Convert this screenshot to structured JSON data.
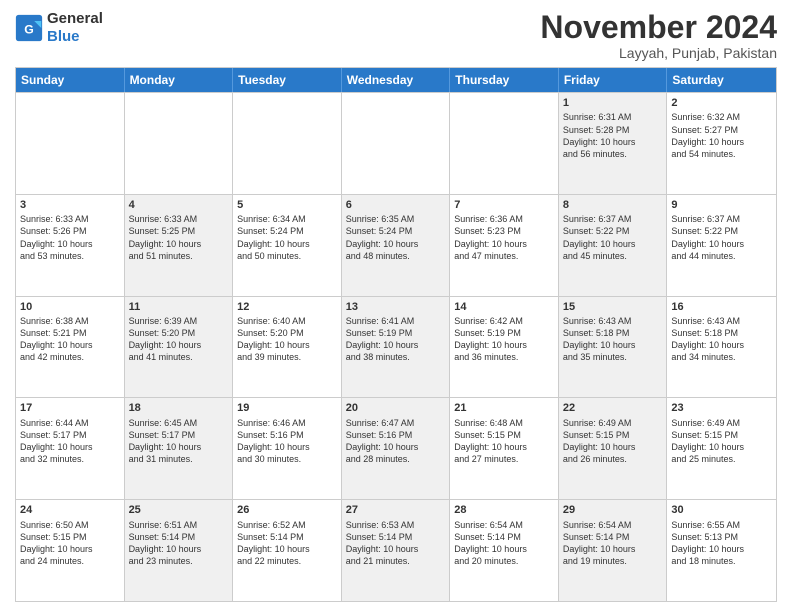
{
  "logo": {
    "line1": "General",
    "line2": "Blue"
  },
  "title": "November 2024",
  "location": "Layyah, Punjab, Pakistan",
  "header_days": [
    "Sunday",
    "Monday",
    "Tuesday",
    "Wednesday",
    "Thursday",
    "Friday",
    "Saturday"
  ],
  "rows": [
    {
      "cells": [
        {
          "day": "",
          "info": "",
          "shaded": false,
          "empty": true
        },
        {
          "day": "",
          "info": "",
          "shaded": false,
          "empty": true
        },
        {
          "day": "",
          "info": "",
          "shaded": false,
          "empty": true
        },
        {
          "day": "",
          "info": "",
          "shaded": false,
          "empty": true
        },
        {
          "day": "",
          "info": "",
          "shaded": false,
          "empty": true
        },
        {
          "day": "1",
          "info": "Sunrise: 6:31 AM\nSunset: 5:28 PM\nDaylight: 10 hours\nand 56 minutes.",
          "shaded": true,
          "empty": false
        },
        {
          "day": "2",
          "info": "Sunrise: 6:32 AM\nSunset: 5:27 PM\nDaylight: 10 hours\nand 54 minutes.",
          "shaded": false,
          "empty": false
        }
      ]
    },
    {
      "cells": [
        {
          "day": "3",
          "info": "Sunrise: 6:33 AM\nSunset: 5:26 PM\nDaylight: 10 hours\nand 53 minutes.",
          "shaded": false,
          "empty": false
        },
        {
          "day": "4",
          "info": "Sunrise: 6:33 AM\nSunset: 5:25 PM\nDaylight: 10 hours\nand 51 minutes.",
          "shaded": true,
          "empty": false
        },
        {
          "day": "5",
          "info": "Sunrise: 6:34 AM\nSunset: 5:24 PM\nDaylight: 10 hours\nand 50 minutes.",
          "shaded": false,
          "empty": false
        },
        {
          "day": "6",
          "info": "Sunrise: 6:35 AM\nSunset: 5:24 PM\nDaylight: 10 hours\nand 48 minutes.",
          "shaded": true,
          "empty": false
        },
        {
          "day": "7",
          "info": "Sunrise: 6:36 AM\nSunset: 5:23 PM\nDaylight: 10 hours\nand 47 minutes.",
          "shaded": false,
          "empty": false
        },
        {
          "day": "8",
          "info": "Sunrise: 6:37 AM\nSunset: 5:22 PM\nDaylight: 10 hours\nand 45 minutes.",
          "shaded": true,
          "empty": false
        },
        {
          "day": "9",
          "info": "Sunrise: 6:37 AM\nSunset: 5:22 PM\nDaylight: 10 hours\nand 44 minutes.",
          "shaded": false,
          "empty": false
        }
      ]
    },
    {
      "cells": [
        {
          "day": "10",
          "info": "Sunrise: 6:38 AM\nSunset: 5:21 PM\nDaylight: 10 hours\nand 42 minutes.",
          "shaded": false,
          "empty": false
        },
        {
          "day": "11",
          "info": "Sunrise: 6:39 AM\nSunset: 5:20 PM\nDaylight: 10 hours\nand 41 minutes.",
          "shaded": true,
          "empty": false
        },
        {
          "day": "12",
          "info": "Sunrise: 6:40 AM\nSunset: 5:20 PM\nDaylight: 10 hours\nand 39 minutes.",
          "shaded": false,
          "empty": false
        },
        {
          "day": "13",
          "info": "Sunrise: 6:41 AM\nSunset: 5:19 PM\nDaylight: 10 hours\nand 38 minutes.",
          "shaded": true,
          "empty": false
        },
        {
          "day": "14",
          "info": "Sunrise: 6:42 AM\nSunset: 5:19 PM\nDaylight: 10 hours\nand 36 minutes.",
          "shaded": false,
          "empty": false
        },
        {
          "day": "15",
          "info": "Sunrise: 6:43 AM\nSunset: 5:18 PM\nDaylight: 10 hours\nand 35 minutes.",
          "shaded": true,
          "empty": false
        },
        {
          "day": "16",
          "info": "Sunrise: 6:43 AM\nSunset: 5:18 PM\nDaylight: 10 hours\nand 34 minutes.",
          "shaded": false,
          "empty": false
        }
      ]
    },
    {
      "cells": [
        {
          "day": "17",
          "info": "Sunrise: 6:44 AM\nSunset: 5:17 PM\nDaylight: 10 hours\nand 32 minutes.",
          "shaded": false,
          "empty": false
        },
        {
          "day": "18",
          "info": "Sunrise: 6:45 AM\nSunset: 5:17 PM\nDaylight: 10 hours\nand 31 minutes.",
          "shaded": true,
          "empty": false
        },
        {
          "day": "19",
          "info": "Sunrise: 6:46 AM\nSunset: 5:16 PM\nDaylight: 10 hours\nand 30 minutes.",
          "shaded": false,
          "empty": false
        },
        {
          "day": "20",
          "info": "Sunrise: 6:47 AM\nSunset: 5:16 PM\nDaylight: 10 hours\nand 28 minutes.",
          "shaded": true,
          "empty": false
        },
        {
          "day": "21",
          "info": "Sunrise: 6:48 AM\nSunset: 5:15 PM\nDaylight: 10 hours\nand 27 minutes.",
          "shaded": false,
          "empty": false
        },
        {
          "day": "22",
          "info": "Sunrise: 6:49 AM\nSunset: 5:15 PM\nDaylight: 10 hours\nand 26 minutes.",
          "shaded": true,
          "empty": false
        },
        {
          "day": "23",
          "info": "Sunrise: 6:49 AM\nSunset: 5:15 PM\nDaylight: 10 hours\nand 25 minutes.",
          "shaded": false,
          "empty": false
        }
      ]
    },
    {
      "cells": [
        {
          "day": "24",
          "info": "Sunrise: 6:50 AM\nSunset: 5:15 PM\nDaylight: 10 hours\nand 24 minutes.",
          "shaded": false,
          "empty": false
        },
        {
          "day": "25",
          "info": "Sunrise: 6:51 AM\nSunset: 5:14 PM\nDaylight: 10 hours\nand 23 minutes.",
          "shaded": true,
          "empty": false
        },
        {
          "day": "26",
          "info": "Sunrise: 6:52 AM\nSunset: 5:14 PM\nDaylight: 10 hours\nand 22 minutes.",
          "shaded": false,
          "empty": false
        },
        {
          "day": "27",
          "info": "Sunrise: 6:53 AM\nSunset: 5:14 PM\nDaylight: 10 hours\nand 21 minutes.",
          "shaded": true,
          "empty": false
        },
        {
          "day": "28",
          "info": "Sunrise: 6:54 AM\nSunset: 5:14 PM\nDaylight: 10 hours\nand 20 minutes.",
          "shaded": false,
          "empty": false
        },
        {
          "day": "29",
          "info": "Sunrise: 6:54 AM\nSunset: 5:14 PM\nDaylight: 10 hours\nand 19 minutes.",
          "shaded": true,
          "empty": false
        },
        {
          "day": "30",
          "info": "Sunrise: 6:55 AM\nSunset: 5:13 PM\nDaylight: 10 hours\nand 18 minutes.",
          "shaded": false,
          "empty": false
        }
      ]
    }
  ]
}
